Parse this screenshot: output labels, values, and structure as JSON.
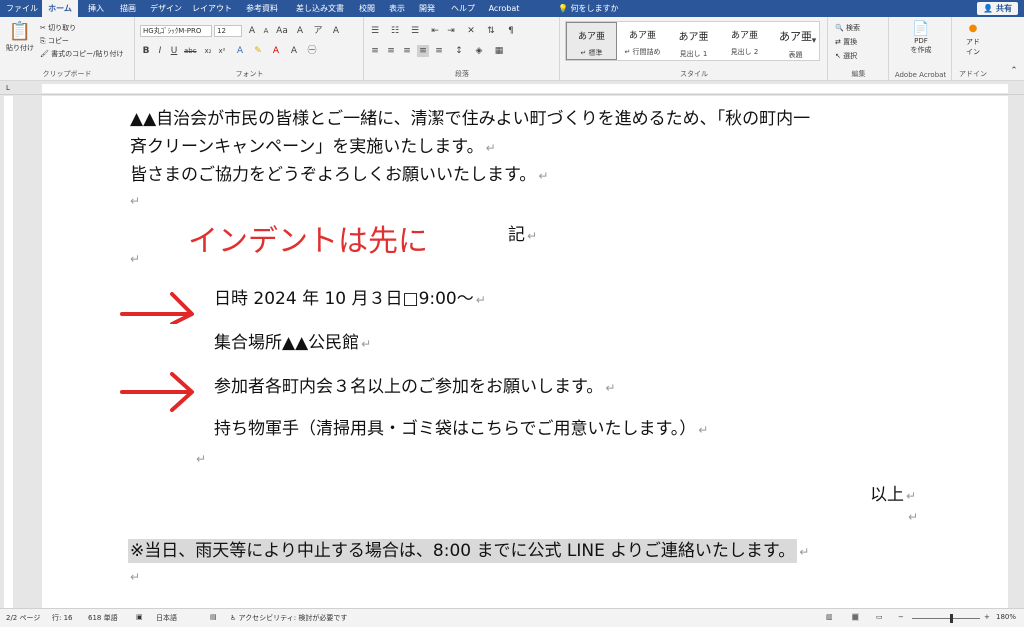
{
  "ribbon_tabs": [
    "ファイル",
    "ホーム",
    "挿入",
    "描画",
    "デザイン",
    "レイアウト",
    "参考資料",
    "差し込み文書",
    "校閲",
    "表示",
    "開発",
    "ヘルプ",
    "Acrobat"
  ],
  "active_tab": "ホーム",
  "search_hint": "何をしますか",
  "share_label": "共有",
  "clipboard": {
    "paste_label": "貼り付け",
    "cut_label": "切り取り",
    "copy_label": "コピー",
    "format_painter_label": "書式のコピー/貼り付け",
    "group_label": "クリップボード"
  },
  "font": {
    "font_name": "HG丸ｺﾞｼｯｸM-PRO",
    "font_size": "12",
    "group_label": "フォント"
  },
  "paragraph": {
    "group_label": "段落"
  },
  "styles": {
    "items": [
      {
        "preview": "あア亜",
        "name": "↵ 標準"
      },
      {
        "preview": "あア亜",
        "name": "↵ 行間詰め"
      },
      {
        "preview": "あア亜",
        "name": "見出し 1"
      },
      {
        "preview": "あア亜",
        "name": "見出し 2"
      },
      {
        "preview": "あア亜",
        "name": "表題"
      }
    ],
    "group_label": "スタイル"
  },
  "editing": {
    "find_label": "検索",
    "replace_label": "置換",
    "select_label": "選択",
    "group_label": "編集"
  },
  "acrobat": {
    "pdf_line1": "PDF",
    "pdf_line2": "を作成",
    "group_label": "Adobe Acrobat"
  },
  "addin": {
    "line1": "アド",
    "line2": "イン",
    "group_label": "アドイン"
  },
  "document": {
    "line1": "▲▲自治会が市民の皆様とご一緒に、清潔で住みよい町づくりを進めるため、「秋の町内一",
    "line2": "斉クリーンキャンペーン」を実施いたします。",
    "line3": "皆さまのご協力をどうぞよろしくお願いいたします。",
    "ki": "記",
    "item1": "日時 2024 年 10 月３日□9:00～",
    "item2": "集合場所▲▲公民館",
    "item3": "参加者各町内会３名以上のご参加をお願いします。",
    "item4": "持ち物軍手（清掃用具・ゴミ袋はこちらでご用意いたします。）",
    "ijo": "以上",
    "note": "※当日、雨天等により中止する場合は、8:00 までに公式 LINE よりご連絡いたします。",
    "para_mark": "↵"
  },
  "annotation": {
    "text": "インデントは先に",
    "color": "#e03030"
  },
  "statusbar": {
    "page": "2/2 ページ",
    "line": "行: 16",
    "words": "618 単語",
    "language": "日本語",
    "accessibility": "アクセシビリティ: 検討が必要です",
    "zoom": "180%"
  },
  "colors": {
    "tab_bar": "#2b579a",
    "ribbon_bg": "#f3f3f3"
  }
}
